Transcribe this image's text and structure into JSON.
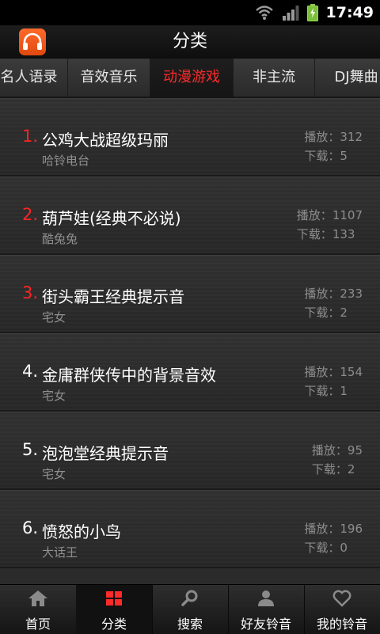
{
  "status_bar": {
    "time": "17:49"
  },
  "header": {
    "title": "分类"
  },
  "tabs": [
    {
      "label": "名人语录",
      "active": false
    },
    {
      "label": "音效音乐",
      "active": false
    },
    {
      "label": "动漫游戏",
      "active": true
    },
    {
      "label": "非主流",
      "active": false
    },
    {
      "label": "DJ舞曲",
      "active": false
    }
  ],
  "list": {
    "play_label": "播放：",
    "download_label": "下载：",
    "items": [
      {
        "rank": "1.",
        "title": "公鸡大战超级玛丽",
        "author": "哈铃电台",
        "plays": "312",
        "downloads": "5"
      },
      {
        "rank": "2.",
        "title": "葫芦娃(经典不必说)",
        "author": "酷兔兔",
        "plays": "1107",
        "downloads": "133"
      },
      {
        "rank": "3.",
        "title": "街头霸王经典提示音",
        "author": "宅女",
        "plays": "233",
        "downloads": "2"
      },
      {
        "rank": "4.",
        "title": "金庸群侠传中的背景音效",
        "author": "宅女",
        "plays": "154",
        "downloads": "1"
      },
      {
        "rank": "5.",
        "title": "泡泡堂经典提示音",
        "author": "宅女",
        "plays": "95",
        "downloads": "2"
      },
      {
        "rank": "6.",
        "title": "愤怒的小鸟",
        "author": "大话王",
        "plays": "196",
        "downloads": "0"
      }
    ]
  },
  "bottom_nav": [
    {
      "label": "首页",
      "icon": "home-icon",
      "active": false
    },
    {
      "label": "分类",
      "icon": "category-icon",
      "active": true
    },
    {
      "label": "搜索",
      "icon": "search-icon",
      "active": false
    },
    {
      "label": "好友铃音",
      "icon": "friends-icon",
      "active": false
    },
    {
      "label": "我的铃音",
      "icon": "heart-icon",
      "active": false
    }
  ],
  "colors": {
    "accent_red": "#ff2424",
    "app_logo_orange": "#ff6a2a"
  }
}
